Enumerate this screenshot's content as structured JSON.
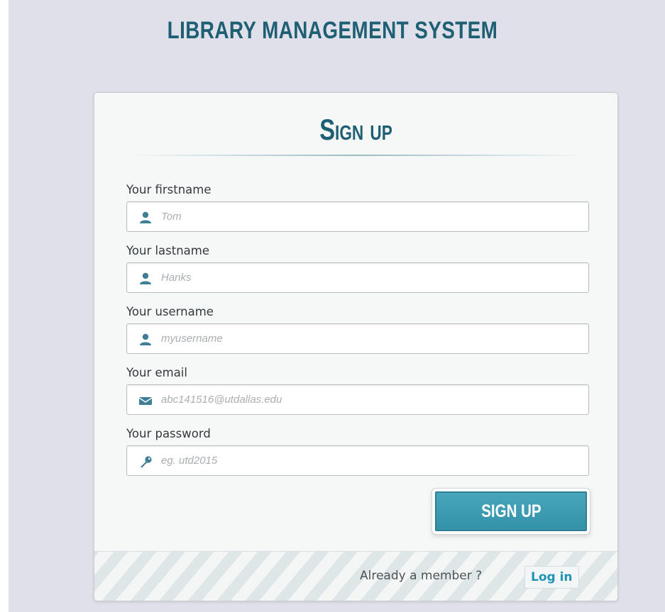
{
  "app": {
    "title": "LIBRARY MANAGEMENT SYSTEM"
  },
  "form": {
    "heading": "Sign up",
    "fields": [
      {
        "label": "Your firstname",
        "placeholder": "Tom",
        "icon": "user-icon"
      },
      {
        "label": "Your lastname",
        "placeholder": "Hanks",
        "icon": "user-icon"
      },
      {
        "label": "Your username",
        "placeholder": "myusername",
        "icon": "user-icon"
      },
      {
        "label": "Your email",
        "placeholder": "abc141516@utdallas.edu",
        "icon": "envelope-icon"
      },
      {
        "label": "Your password",
        "placeholder": "eg. utd2015",
        "icon": "key-icon"
      }
    ],
    "submit_label": "SIGN UP"
  },
  "footer": {
    "text": "Already a member ?",
    "login_label": "Log in"
  },
  "colors": {
    "brand": "#1e5f74",
    "button": "#3b9cb3",
    "link": "#1f93b4",
    "icon": "#3f7f95",
    "background": "#e0e0ea"
  }
}
